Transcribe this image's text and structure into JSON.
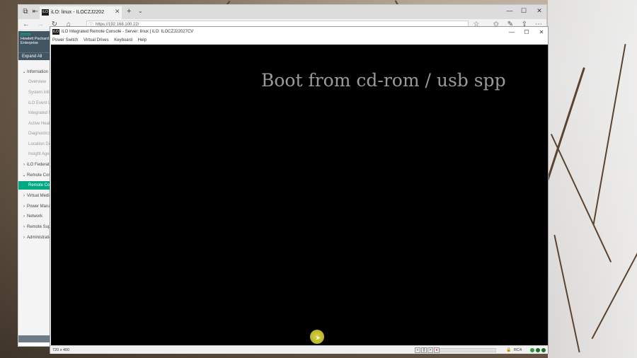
{
  "browser": {
    "tab_title": "iLO: linux - ILOCZJ2202",
    "tab_badge": "iLO",
    "address": "https://192.168.100.22/",
    "icons": {
      "back": "arrow-left-icon",
      "forward": "arrow-right-icon",
      "refresh": "refresh-icon",
      "home": "home-icon",
      "favorite": "star-icon",
      "favorites_list": "favorites-icon",
      "notes": "pen-icon",
      "share": "share-icon",
      "more": "more-icon"
    }
  },
  "sidebar": {
    "brand_line1": "Hewlett Packard",
    "brand_line2": "Enterprise",
    "expand_all": "Expand All",
    "items": [
      {
        "label": "Information",
        "type": "top",
        "state": "expanded"
      },
      {
        "label": "Overview",
        "type": "sub"
      },
      {
        "label": "System Information",
        "type": "sub"
      },
      {
        "label": "iLO Event Log",
        "type": "sub"
      },
      {
        "label": "Integrated Management Log",
        "type": "sub"
      },
      {
        "label": "Active Health System Log",
        "type": "sub"
      },
      {
        "label": "Diagnostics",
        "type": "sub"
      },
      {
        "label": "Location Discovery Services",
        "type": "sub"
      },
      {
        "label": "Insight Agent",
        "type": "sub"
      },
      {
        "label": "iLO Federation",
        "type": "top",
        "state": "collapsed"
      },
      {
        "label": "Remote Console",
        "type": "top",
        "state": "expanded"
      },
      {
        "label": "Remote Console",
        "type": "sub",
        "active": true
      },
      {
        "label": "Virtual Media",
        "type": "top",
        "state": "collapsed"
      },
      {
        "label": "Power Management",
        "type": "top",
        "state": "collapsed"
      },
      {
        "label": "Network",
        "type": "top",
        "state": "collapsed"
      },
      {
        "label": "Remote Support",
        "type": "top",
        "state": "collapsed"
      },
      {
        "label": "Administration",
        "type": "top",
        "state": "collapsed"
      }
    ]
  },
  "console": {
    "title": "iLO Integrated Remote Console - Server: linux | iLO: ILOCZJ22027CV",
    "badge": "iLO",
    "menu": [
      "Power Switch",
      "Virtual Drives",
      "Keyboard",
      "Help"
    ],
    "screen_text": "Boot from cd-rom / usb spp",
    "status": {
      "resolution": "720 x 400",
      "encryption": "RC4",
      "playback_buttons": [
        "«",
        "||",
        ">",
        "●"
      ],
      "indicator_colors": [
        "#2e9c3a",
        "#1d6e28",
        "#1d6e28"
      ]
    }
  }
}
